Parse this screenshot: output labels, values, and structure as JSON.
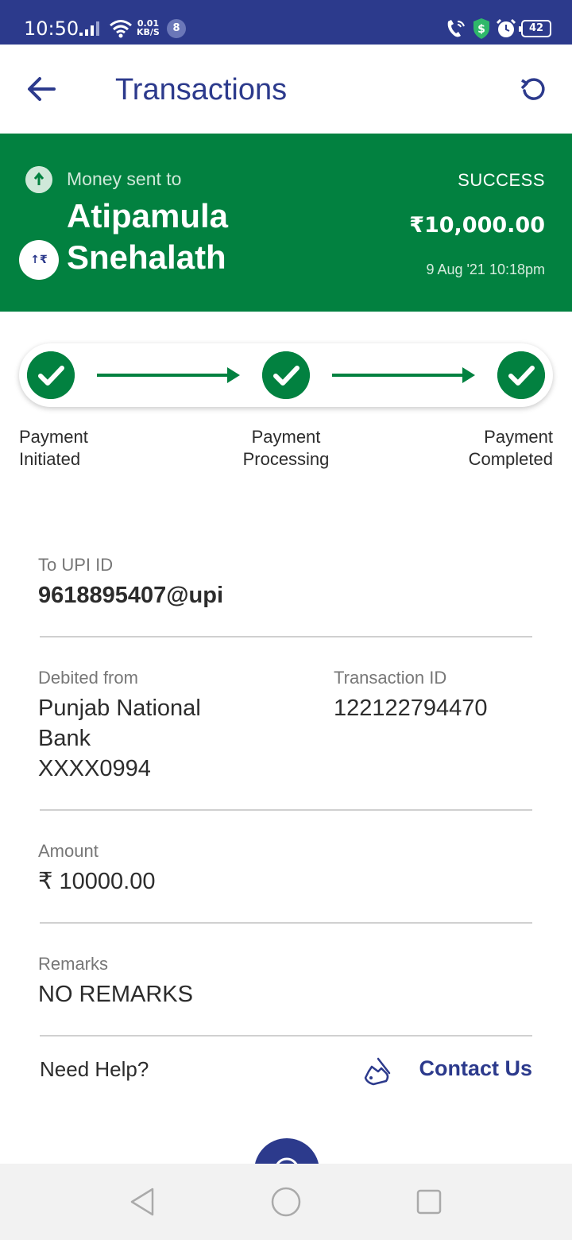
{
  "status_bar": {
    "time": "10:50",
    "net_speed_value": "0.01",
    "net_speed_unit": "KB/S",
    "notification_count": "8",
    "battery": "42",
    "icons": [
      "signal-icon",
      "wifi-icon",
      "wifi-call-icon",
      "security-icon",
      "alarm-icon",
      "battery-icon"
    ]
  },
  "appbar": {
    "title": "Transactions",
    "back_icon": "arrow-left-icon",
    "refresh_icon": "refresh-icon"
  },
  "hero": {
    "direction_label": "Money sent to",
    "payee_name": "Atipamula Snehalath",
    "status": "SUCCESS",
    "amount": "₹10,000.00",
    "datetime": "9 Aug '21 10:18pm",
    "rupee_badge": "↑₹"
  },
  "progress": {
    "steps": [
      {
        "label_line1": "Payment",
        "label_line2": "Initiated"
      },
      {
        "label_line1": "Payment",
        "label_line2": "Processing"
      },
      {
        "label_line1": "Payment",
        "label_line2": "Completed"
      }
    ]
  },
  "details": {
    "upi_label": "To UPI ID",
    "upi_value": "9618895407@upi",
    "debited_label": "Debited from",
    "debited_line1": "Punjab National",
    "debited_line2": "Bank",
    "debited_line3": "XXXX0994",
    "txn_label": "Transaction ID",
    "txn_value": "122122794470",
    "amount_label": "Amount",
    "amount_value": "₹ 10000.00",
    "remarks_label": "Remarks",
    "remarks_value": "NO REMARKS"
  },
  "help": {
    "question": "Need Help?",
    "contact_label": "Contact Us"
  },
  "colors": {
    "brand_blue": "#2c3a8c",
    "success_green": "#028140"
  }
}
